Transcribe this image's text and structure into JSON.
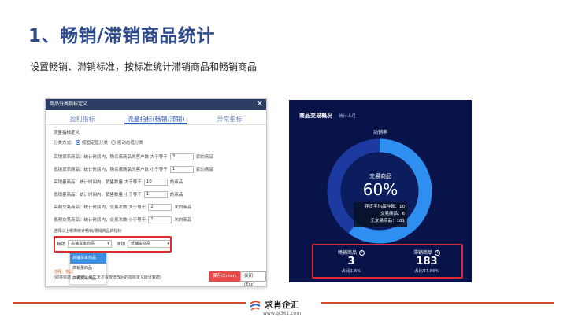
{
  "slide": {
    "title": "1、畅销/滞销商品统计",
    "subtitle": "设置畅销、滞销标准，按标准统计滞销商品和畅销商品"
  },
  "dialog": {
    "title": "商品分类指标定义",
    "close_glyph": "✕",
    "tabs": [
      {
        "label": "盈利指标",
        "active": false
      },
      {
        "label": "流量指标(畅销/滞销)",
        "active": true
      },
      {
        "label": "异常指标",
        "active": false
      }
    ],
    "section_label": "流量指标定义",
    "classify": {
      "label": "分类方式:",
      "option1": "按固定值分类",
      "option2": "按动态值分类",
      "selected": "option1"
    },
    "rows": [
      {
        "prefix": "高铺货率商品：统计时间内，购买该商品的客户数 大于等于",
        "value": "3",
        "suffix": "家的商品"
      },
      {
        "prefix": "低铺货率商品：统计时间内，购买该商品的客户数 小于等于",
        "value": "1",
        "suffix": "家的商品"
      },
      {
        "prefix": "高销量商品：统计时间内，销售数量 大于等于",
        "value": "10",
        "suffix": "的商品"
      },
      {
        "prefix": "低销量商品：统计时间内，销售数量 小于等于",
        "value": "1",
        "suffix": "的商品"
      },
      {
        "prefix": "高频交易商品：统计时间内，交易次数 大于等于",
        "value": "2",
        "suffix": "次的商品"
      },
      {
        "prefix": "低频交易商品：统计时间内，交易次数 小于等于",
        "value": "1",
        "suffix": "次的商品"
      }
    ],
    "tip": "选择以上哪类统计畅销/滞销商品的指标",
    "selects": {
      "best_label": "畅销",
      "best_value": "高铺货率商品",
      "slow_label": "滞销",
      "slow_value": "低铺货商品"
    },
    "dropdown_options": [
      "高铺货率商品",
      "高销量商品",
      "高频交易商品"
    ],
    "dropdown_highlighted": 0,
    "notes": {
      "warn": "注释：特此",
      "text": "(即将依据 ... 数据，第二天才会按修改后的指标定义统计数据)"
    },
    "save_label": "保存(Enter)",
    "close_label": "关闭(Esc)"
  },
  "dashboard": {
    "title": "商品交易概况",
    "period": "统计上月",
    "rate_label": "动销率",
    "center_label": "交易商品",
    "center_value": "60%",
    "ring_fraction": 0.6,
    "stats": [
      {
        "label": "存货平均品种数",
        "value": "10"
      },
      {
        "label": "交易商品",
        "value": "6"
      },
      {
        "label": "无交易商品",
        "value": "181"
      }
    ],
    "kpis": [
      {
        "label": "畅销商品",
        "value": "3",
        "share": "占比1.6%"
      },
      {
        "label": "滞销商品",
        "value": "183",
        "share": "占比97.86%"
      }
    ],
    "help_glyph": "?"
  },
  "footer": {
    "brand": "求肖企汇",
    "url": "www.qf361.com"
  },
  "colors": {
    "title": "#2d4a8a",
    "accent_red": "#e32a2a",
    "dash_bg": "#08134a",
    "ring_active": "#2f8ff0",
    "ring_rest": "#1d3aa0"
  }
}
